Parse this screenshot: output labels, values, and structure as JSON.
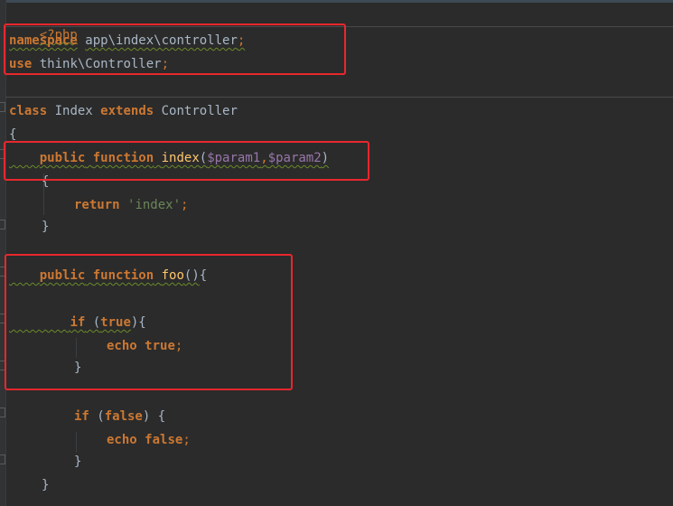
{
  "code": {
    "php_open": "<?php",
    "ns_keyword": "namespace",
    "ns_path": "app\\index\\controller",
    "ns_semi": ";",
    "use_keyword": "use",
    "use_path": "think\\Controller",
    "use_semi": ";",
    "class_kw": "class",
    "class_name": " Index ",
    "extends_kw": "extends",
    "parent_class": " Controller",
    "class_open": "{",
    "m1_public": "public",
    "m1_function": "function",
    "m1_name": "index",
    "m1_open_paren": "(",
    "m1_param1": "$param1",
    "m1_comma": ",",
    "m1_param2": "$param2",
    "m1_close_paren": ")",
    "m1_open": "{",
    "return_kw": "return",
    "return_str": "'index'",
    "return_semi": ";",
    "m1_close": "}",
    "m2_public": "public",
    "m2_function": "function",
    "m2_name": "foo",
    "m2_parens": "()",
    "m2_open": "{",
    "if1_kw": "if",
    "if1_open_paren": " (",
    "if1_cond": "true",
    "if1_close": "){",
    "echo1_kw": "echo",
    "echo1_val": "true",
    "echo1_semi": ";",
    "if1_end": "}",
    "if2_kw": "if",
    "if2_open_paren": " (",
    "if2_cond": "false",
    "if2_close": ") {",
    "echo2_kw": "echo",
    "echo2_val": "false",
    "echo2_semi": ";",
    "if2_end": "}",
    "m2_close": "}"
  },
  "colors": {
    "background": "#2b2b2b",
    "keyword": "#cc7832",
    "function_name": "#ffc66d",
    "variable": "#9876aa",
    "string": "#6a8759",
    "plain": "#a9b7c6",
    "highlight_box": "#e8272d"
  }
}
